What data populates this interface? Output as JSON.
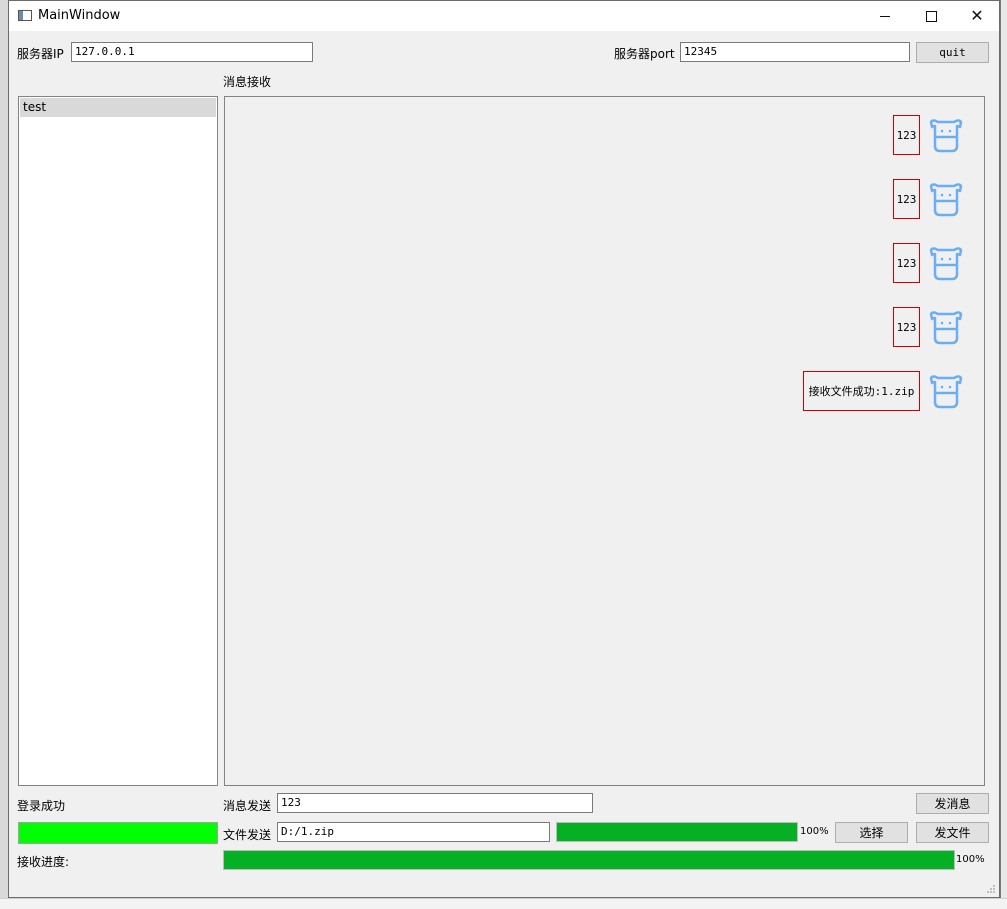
{
  "window": {
    "title": "MainWindow"
  },
  "server": {
    "ip_label": "服务器IP",
    "ip_value": "127.0.0.1",
    "port_label": "服务器port",
    "port_value": "12345",
    "quit_label": "quit"
  },
  "receive_label": "消息接收",
  "users": [
    {
      "name": "test"
    }
  ],
  "messages": [
    {
      "text": "123"
    },
    {
      "text": "123"
    },
    {
      "text": "123"
    },
    {
      "text": "123"
    },
    {
      "text": "接收文件成功:1.zip"
    }
  ],
  "status_text": "登录成功",
  "send_message": {
    "label": "消息发送",
    "value": "123",
    "button": "发消息"
  },
  "send_file": {
    "label": "文件发送",
    "value": "D:/1.zip",
    "progress": 100,
    "progress_text": "100%",
    "choose_button": "选择",
    "send_button": "发文件"
  },
  "receive_progress": {
    "label": "接收进度:",
    "progress": 100,
    "progress_text": "100%"
  },
  "colors": {
    "progress_green": "#06b025",
    "status_green": "#00ff00",
    "bubble_border": "#d00000",
    "avatar_blue": "#6aaef5"
  },
  "icons": [
    "app-icon",
    "minimize-icon",
    "maximize-icon",
    "close-icon",
    "cow-avatar-icon",
    "resize-grip-icon"
  ]
}
